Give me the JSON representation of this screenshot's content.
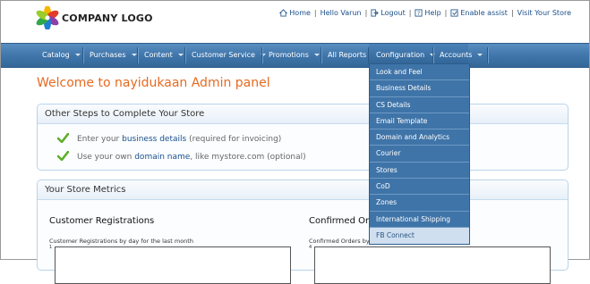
{
  "header": {
    "logo_text": "COMPANY LOGO",
    "links": [
      {
        "label": "Home",
        "icon": "home-icon"
      },
      {
        "label": "Hello Varun",
        "icon": ""
      },
      {
        "label": "Logout",
        "icon": "logout-icon"
      },
      {
        "label": "Help",
        "icon": "help-icon"
      },
      {
        "label": "Enable assist",
        "icon": "assist-icon"
      },
      {
        "label": "Visit Your Store",
        "icon": ""
      }
    ]
  },
  "nav": {
    "items": [
      {
        "label": "Catalog",
        "caret": true
      },
      {
        "label": "Purchases",
        "caret": true
      },
      {
        "label": "Content",
        "caret": true
      },
      {
        "label": "Customer Service",
        "caret": true
      },
      {
        "label": "Promotions",
        "caret": true
      },
      {
        "label": "All Reports",
        "caret": false
      },
      {
        "label": "Configuration",
        "caret": true
      },
      {
        "label": "Accounts",
        "caret": true
      }
    ],
    "open_menu": "Configuration"
  },
  "welcome": "Welcome to nayidukaan Admin panel",
  "steps_panel": {
    "title": "Other Steps to Complete Your Store",
    "steps": [
      {
        "pre": "Enter your ",
        "link": "business details",
        "post": " (required for invoicing)"
      },
      {
        "pre": "Use your own ",
        "link": "domain name",
        "post": ", like mystore.com (optional)"
      }
    ]
  },
  "metrics_panel": {
    "title": "Your Store Metrics",
    "charts": [
      {
        "title": "Customer Registrations",
        "subtitle": "Customer Registrations by day for the last month",
        "tick": "1"
      },
      {
        "title": "Confirmed Orders",
        "subtitle": "Confirmed Orders by",
        "tick": "4"
      }
    ]
  },
  "config_menu": {
    "items": [
      "Look and Feel",
      "Business Details",
      "CS Details",
      "Email Template",
      "Domain and Analytics",
      "Courier",
      "Stores",
      "CoD",
      "Zones",
      "International Shipping",
      "FB Connect"
    ],
    "highlighted": "FB Connect"
  }
}
